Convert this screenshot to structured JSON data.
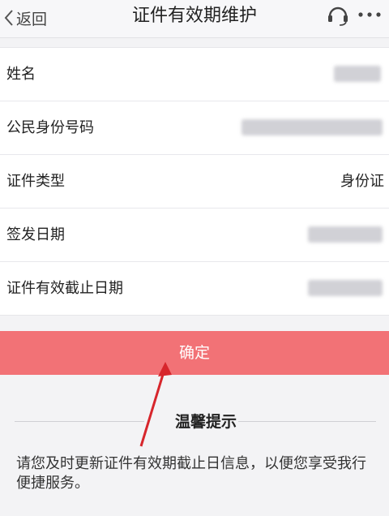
{
  "nav": {
    "back_label": "返回",
    "title": "证件有效期维护",
    "headset_icon": "headset-icon",
    "more_icon": "more-icon"
  },
  "form": {
    "rows": [
      {
        "label": "姓名",
        "value": ""
      },
      {
        "label": "公民身份号码",
        "value": ""
      },
      {
        "label": "证件类型",
        "value": "身份证"
      },
      {
        "label": "签发日期",
        "value": ""
      },
      {
        "label": "证件有效截止日期",
        "value": ""
      }
    ]
  },
  "confirm_label": "确定",
  "tips": {
    "title": "温馨提示",
    "text": "请您及时更新证件有效期截止日信息，以便您享受我行便捷服务。"
  },
  "colors": {
    "accent": "#f27276",
    "annotation_arrow": "#d7262c"
  }
}
